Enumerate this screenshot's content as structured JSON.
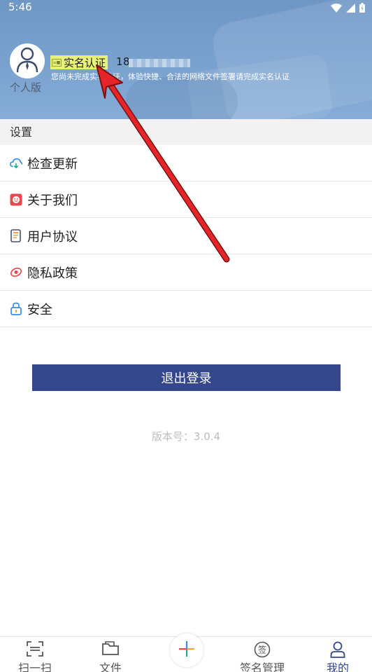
{
  "status_bar": {
    "time": "5:46"
  },
  "profile": {
    "version_label": "个人版",
    "verify_badge_icon": "id-card-icon",
    "verify_label": "实名认证",
    "phone_prefix": "18",
    "notice": "您尚未完成实名认证，体验快捷、合法的网络文件签署请完成实名认证"
  },
  "settings": {
    "title": "设置",
    "items": [
      {
        "label": "检查更新",
        "icon": "cloud-refresh-icon"
      },
      {
        "label": "关于我们",
        "icon": "about-icon"
      },
      {
        "label": "用户协议",
        "icon": "document-icon"
      },
      {
        "label": "隐私政策",
        "icon": "privacy-icon"
      },
      {
        "label": "安全",
        "icon": "lock-icon"
      }
    ]
  },
  "logout_label": "退出登录",
  "version_text": "版本号：3.0.4",
  "bottom_nav": {
    "items": [
      {
        "label": "扫一扫",
        "icon": "scan-icon"
      },
      {
        "label": "文件",
        "icon": "folder-icon"
      },
      {
        "label": "",
        "icon": "plus-icon"
      },
      {
        "label": "签名管理",
        "icon": "signature-icon"
      },
      {
        "label": "我的",
        "icon": "user-icon"
      }
    ],
    "active": "我的"
  },
  "colors": {
    "header_blue": "#7aa2cf",
    "primary": "#34468c",
    "badge_yellow": "#e7f27a",
    "annotation_red": "#e5252a"
  }
}
